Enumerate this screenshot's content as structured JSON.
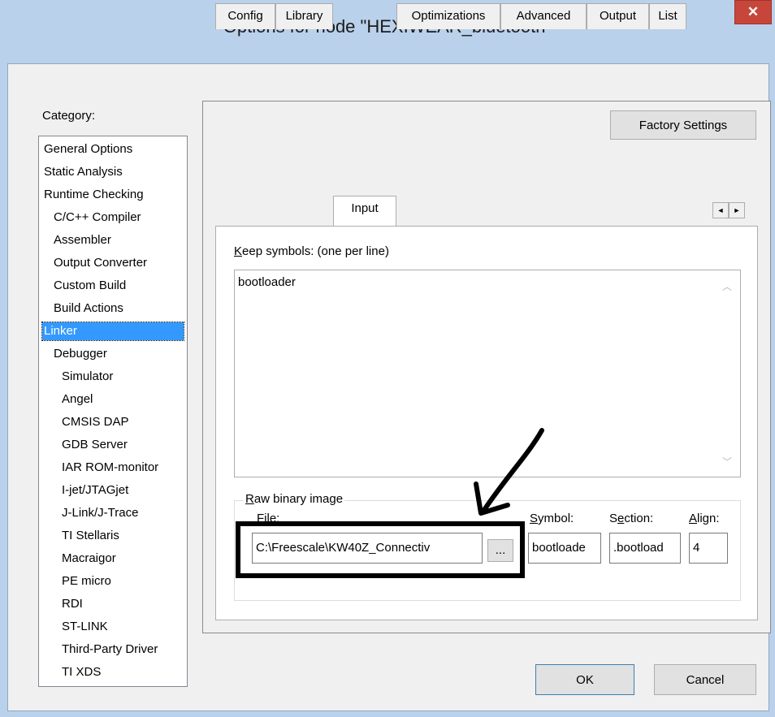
{
  "window": {
    "title": "Options for node \"HEXIWEAR_bluetooth\"",
    "close_glyph": "✕"
  },
  "category": {
    "label": "Category:",
    "items": [
      "General Options",
      "Static Analysis",
      "Runtime Checking",
      "C/C++ Compiler",
      "Assembler",
      "Output Converter",
      "Custom Build",
      "Build Actions",
      "Linker",
      "Debugger",
      "Simulator",
      "Angel",
      "CMSIS DAP",
      "GDB Server",
      "IAR ROM-monitor",
      "I-jet/JTAGjet",
      "J-Link/J-Trace",
      "TI Stellaris",
      "Macraigor",
      "PE micro",
      "RDI",
      "ST-LINK",
      "Third-Party Driver",
      "TI XDS"
    ],
    "selected": "Linker"
  },
  "panel": {
    "factory_settings": "Factory Settings",
    "tabs": [
      "Config",
      "Library",
      "Input",
      "Optimizations",
      "Advanced",
      "Output",
      "List"
    ],
    "active_tab": "Input",
    "scroll_left": "◄",
    "scroll_right": "►"
  },
  "input_page": {
    "keep_label": "Keep symbols: (one per line)",
    "keep_value": "bootloader",
    "raw_group_label": "Raw binary image",
    "file_label": "File:",
    "file_value": "C:\\Freescale\\KW40Z_Connectiv",
    "browse_label": "...",
    "symbol_label": "Symbol:",
    "symbol_value": "bootloade",
    "section_label": "Section:",
    "section_value": ".bootload",
    "align_label": "Align:",
    "align_value": "4"
  },
  "footer": {
    "ok": "OK",
    "cancel": "Cancel"
  },
  "colors": {
    "frame": "#b9d1ea",
    "close": "#c7463c",
    "selection": "#3399ff"
  }
}
